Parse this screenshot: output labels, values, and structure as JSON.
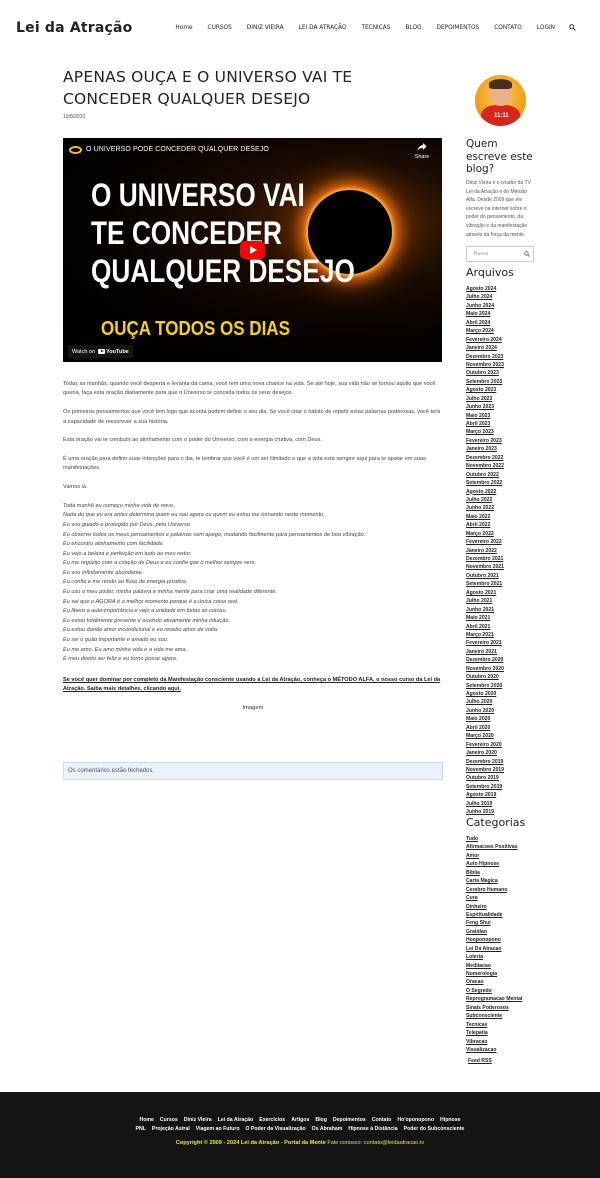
{
  "header": {
    "logo": "Lei da Atração",
    "nav": [
      "Home",
      "Cursos",
      "Diniz Vieira",
      "Lei da Atração",
      "Tecnicas",
      "Blog",
      "Depoimentos",
      "Contato",
      "Login"
    ]
  },
  "post": {
    "title": "APENAS OUÇA E O UNIVERSO VAI TE CONCEDER QUALQUER DESEJO",
    "date": "19/8/2020",
    "video": {
      "title": "O UNIVERSO PODE CONCEDER QUALQUER DESEJO",
      "share": "Share",
      "headline": [
        "O UNIVERSO VAI",
        "TE CONCEDER",
        "QUALQUER DESEJO"
      ],
      "tagline": "OUÇA TODOS OS DIAS",
      "watch_on": "Watch on",
      "youtube": "YouTube"
    },
    "paragraphs": [
      "Todas as manhãs, quando você desperta e levanta da cama, você tem uma nova chance na vida. Se até hoje, sua vida não se tornou aquilo que você queria, faça esta oração diariamente para que o Universo te conceda todos os seus desejos.",
      "Os primeiros pensamentos que você tem logo que acorda podem definir o seu dia. Se você criar o hábito de repetir estas palavras poderosas, você terá a capacidade de reescrever a sua história.",
      "Esta oração vai te conduzir ao alinhamento com o poder do Universo, com a energia criativa, com Deus.",
      "É uma oração para definir suas intenções para o dia, te lembrar que você é um ser ilimitado e que a vida está sempre aqui para te apoiar em suas manifestações.",
      "Vamos lá."
    ],
    "prayer": [
      "Toda manhã eu começo minha vida de novo.",
      "Nada do que eu era antes determina quem eu sou agora ou quem eu estou me tornando neste momento.",
      "Eu sou guiado e protegido por Deus, pelo Universo.",
      "Eu observo todos os meus pensamentos e palavras sem apego, mudando facilmente para pensamentos de boa vibração.",
      "Eu encontro alinhamento com facilidade.",
      "Eu vejo a beleza e perfeição em tudo ao meu redor.",
      "Eu me regozijo com a criação de Deus e eu confio que o melhor sempre vem.",
      "Eu sou infinitamente abundante.",
      "Eu confio e me rendo ao fluxo de energia positiva.",
      "Eu uso o meu poder, minha palavra e minha mente para criar uma realidade diferente.",
      "Eu sei que o AGORA é o melhor momento porque é a única coisa real.",
      "Eu libero a auto-importância e vejo a unidade em todas as coisas.",
      "Eu estou totalmente presente e ouvindo ativamente minha intuição.",
      "Eu estou dando amor incondicional e eu recebo amor de volta.",
      "Eu sei o quão importante e amado eu sou.",
      "Eu me amo. Eu amo minha vida e a vida me ama.",
      "É meu direito ser feliz e eu torno posse agora."
    ],
    "cta": "Se você quer dominar por completo da Manifestação consciente usando a Lei da Atração, conheça o MÉTODO ALFA, o nosso curso da Lei da Atração. Saiba mais detalhes, clicando aqui.",
    "image_alt": "Imagem",
    "comments_closed": "Os comentários estão fechados."
  },
  "sidebar": {
    "avatar_text": "11:11",
    "about_title": "Quem escreve este blog?",
    "about_text": "Diniz Vieira é o criador da TV Lei da Atração e do Método Alfa. Desde 2009 que ele escreve na internet sobre o poder do pensamento, da vibração e da manifestação através da força da mente.",
    "search_placeholder": "Busca",
    "archives_title": "Arquivos",
    "archives": [
      "Agosto 2024",
      "Julho 2024",
      "Junho 2024",
      "Maio 2024",
      "Abril 2024",
      "Março 2024",
      "Fevereiro 2024",
      "Janeiro 2024",
      "Dezembro 2023",
      "Novembro 2023",
      "Outubro 2023",
      "Setembro 2023",
      "Agosto 2023",
      "Julho 2023",
      "Junho 2023",
      "Maio 2023",
      "Abril 2023",
      "Março 2023",
      "Fevereiro 2023",
      "Janeiro 2023",
      "Dezembro 2022",
      "Novembro 2022",
      "Outubro 2022",
      "Setembro 2022",
      "Agosto 2022",
      "Julho 2022",
      "Junho 2022",
      "Maio 2022",
      "Abril 2022",
      "Março 2022",
      "Fevereiro 2022",
      "Janeiro 2022",
      "Dezembro 2021",
      "Novembro 2021",
      "Outubro 2021",
      "Setembro 2021",
      "Agosto 2021",
      "Julho 2021",
      "Junho 2021",
      "Maio 2021",
      "Abril 2021",
      "Março 2021",
      "Fevereiro 2021",
      "Janeiro 2021",
      "Dezembro 2020",
      "Novembro 2020",
      "Outubro 2020",
      "Setembro 2020",
      "Agosto 2020",
      "Julho 2020",
      "Junho 2020",
      "Maio 2020",
      "Abril 2020",
      "Março 2020",
      "Fevereiro 2020",
      "Janeiro 2020",
      "Dezembro 2019",
      "Novembro 2019",
      "Outubro 2019",
      "Setembro 2019",
      "Agosto 2019",
      "Julho 2019",
      "Junho 2019"
    ],
    "categories_title": "Categorias",
    "categories": [
      "Tudo",
      "Afirmacoes Positivas",
      "Amor",
      "Auto Hipnose",
      "Biblia",
      "Carta Magica",
      "Cerebro Humano",
      "Cura",
      "Dinheiro",
      "Espiritualidade",
      "Feng Shui",
      "Gratidao",
      "Hooponopono",
      "Lei Da Atracao",
      "Loteria",
      "Meditacao",
      "Numerologia",
      "Oracao",
      "O Segredo",
      "Reprogramacao Mental",
      "Sinais Poderosos",
      "Subconsciente",
      "Tecnicas",
      "Telepatia",
      "Vibracao",
      "Visualizacao"
    ],
    "feed": "Feed RSS"
  },
  "footer": {
    "links_row1": [
      "Home",
      "Cursos",
      "Diniz Vieira",
      "Lei da Atração",
      "Exercícios",
      "Artigos",
      "Blog",
      "Depoimentos",
      "Contato",
      "Ho'oponopono",
      "Hipnose"
    ],
    "links_row2": [
      "PNL",
      "Projeção Astral",
      "Viagem ao Futuro",
      "O Poder da Visualização",
      "Os Abraham",
      "Hipnose à Distância",
      "Poder do Subconsciente"
    ],
    "copyright": "Copyright © 2009 - 2024 Lei da Atração - Portal da Mente",
    "contact": "Fale conosco: contato@leidaatracao.tv"
  }
}
